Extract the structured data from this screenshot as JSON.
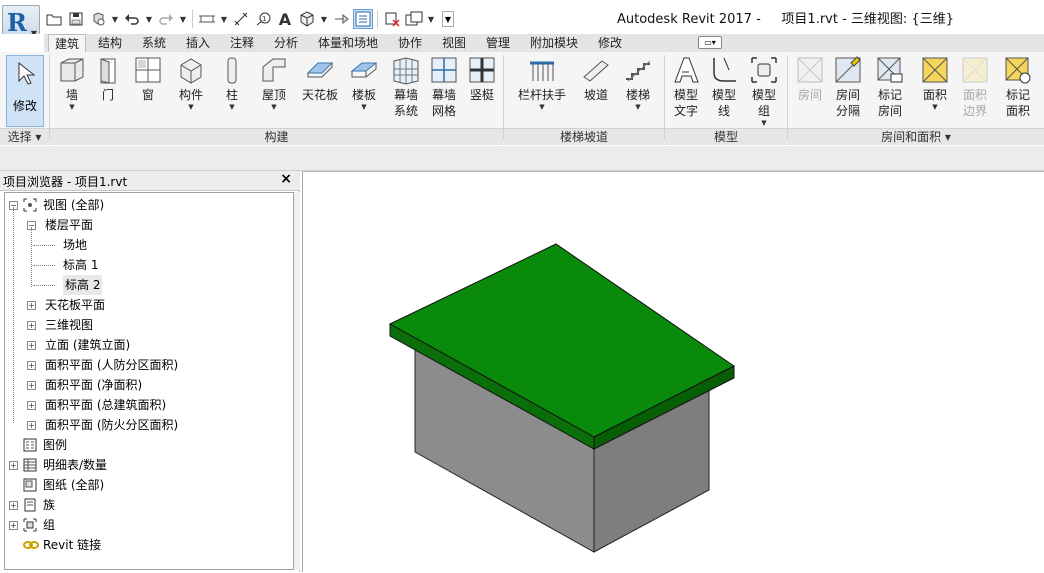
{
  "app": {
    "logo_letter": "R",
    "title": "Autodesk Revit 2017 -     项目1.rvt - 三维视图: {三维}"
  },
  "tabs": [
    "建筑",
    "结构",
    "系统",
    "插入",
    "注释",
    "分析",
    "体量和场地",
    "协作",
    "视图",
    "管理",
    "附加模块",
    "修改"
  ],
  "ribbon": {
    "select": {
      "label": "修改",
      "panel": "选择"
    },
    "build": {
      "panel": "构建",
      "tools": [
        {
          "label": "墙",
          "icon": "wall-icon",
          "has_menu": true
        },
        {
          "label": "门",
          "icon": "door-icon",
          "has_menu": false
        },
        {
          "label": "窗",
          "icon": "window-icon",
          "has_menu": false
        },
        {
          "label": "构件",
          "icon": "component-icon",
          "has_menu": true
        },
        {
          "label": "柱",
          "icon": "column-icon",
          "has_menu": true
        },
        {
          "label": "屋顶",
          "icon": "roof-icon",
          "has_menu": true
        },
        {
          "label": "天花板",
          "icon": "ceiling-icon",
          "has_menu": false
        },
        {
          "label": "楼板",
          "icon": "floor-icon",
          "has_menu": true
        },
        {
          "label": "幕墙\n系统",
          "icon": "curtain-system-icon",
          "has_menu": false
        },
        {
          "label": "幕墙\n网格",
          "icon": "curtain-grid-icon",
          "has_menu": false
        },
        {
          "label": "竖梃",
          "icon": "mullion-icon",
          "has_menu": false
        }
      ]
    },
    "circulation": {
      "panel": "楼梯坡道",
      "tools": [
        {
          "label": "栏杆扶手",
          "icon": "railing-icon",
          "has_menu": true
        },
        {
          "label": "坡道",
          "icon": "ramp-icon",
          "has_menu": false
        },
        {
          "label": "楼梯",
          "icon": "stair-icon",
          "has_menu": true
        }
      ]
    },
    "model": {
      "panel": "模型",
      "tools": [
        {
          "label": "模型\n文字",
          "icon": "model-text-icon",
          "has_menu": false
        },
        {
          "label": "模型\n线",
          "icon": "model-line-icon",
          "has_menu": false
        },
        {
          "label": "模型\n组",
          "icon": "model-group-icon",
          "has_menu": true
        }
      ]
    },
    "room_area": {
      "panel": "房间和面积",
      "tools": [
        {
          "label": "房间",
          "icon": "room-icon",
          "disabled": true
        },
        {
          "label": "房间\n分隔",
          "icon": "room-separator-icon",
          "disabled": false
        },
        {
          "label": "标记\n房间",
          "icon": "tag-room-icon",
          "disabled": false,
          "has_menu": true
        },
        {
          "label": "面积",
          "icon": "area-icon",
          "disabled": false,
          "has_menu": true
        },
        {
          "label": "面积\n边界",
          "icon": "area-boundary-icon",
          "disabled": true
        },
        {
          "label": "标记\n面积",
          "icon": "tag-area-icon",
          "disabled": false,
          "has_menu": true
        }
      ]
    }
  },
  "browser": {
    "title": "项目浏览器 - 项目1.rvt",
    "tree": [
      {
        "label": "视图 (全部)",
        "toggle": "−",
        "icon": "views-icon"
      },
      {
        "label": "楼层平面",
        "toggle": "−"
      },
      {
        "label": "场地"
      },
      {
        "label": "标高 1"
      },
      {
        "label": "标高 2",
        "selected": true
      },
      {
        "label": "天花板平面",
        "toggle": "+"
      },
      {
        "label": "三维视图",
        "toggle": "+"
      },
      {
        "label": "立面 (建筑立面)",
        "toggle": "+"
      },
      {
        "label": "面积平面 (人防分区面积)",
        "toggle": "+"
      },
      {
        "label": "面积平面 (净面积)",
        "toggle": "+"
      },
      {
        "label": "面积平面 (总建筑面积)",
        "toggle": "+"
      },
      {
        "label": "面积平面 (防火分区面积)",
        "toggle": "+"
      },
      {
        "label": "图例",
        "icon": "legend-icon"
      },
      {
        "label": "明细表/数量",
        "toggle": "+",
        "icon": "schedule-icon"
      },
      {
        "label": "图纸 (全部)",
        "icon": "sheet-icon"
      },
      {
        "label": "族",
        "toggle": "+",
        "icon": "family-icon"
      },
      {
        "label": "组",
        "toggle": "+",
        "icon": "group-icon"
      },
      {
        "label": "Revit 链接",
        "icon": "link-icon"
      }
    ]
  },
  "model_view": {
    "roof_color": "#0a8a0a",
    "wall_color": "#8c8c8c",
    "wall_color_dark": "#7e7e7e"
  }
}
